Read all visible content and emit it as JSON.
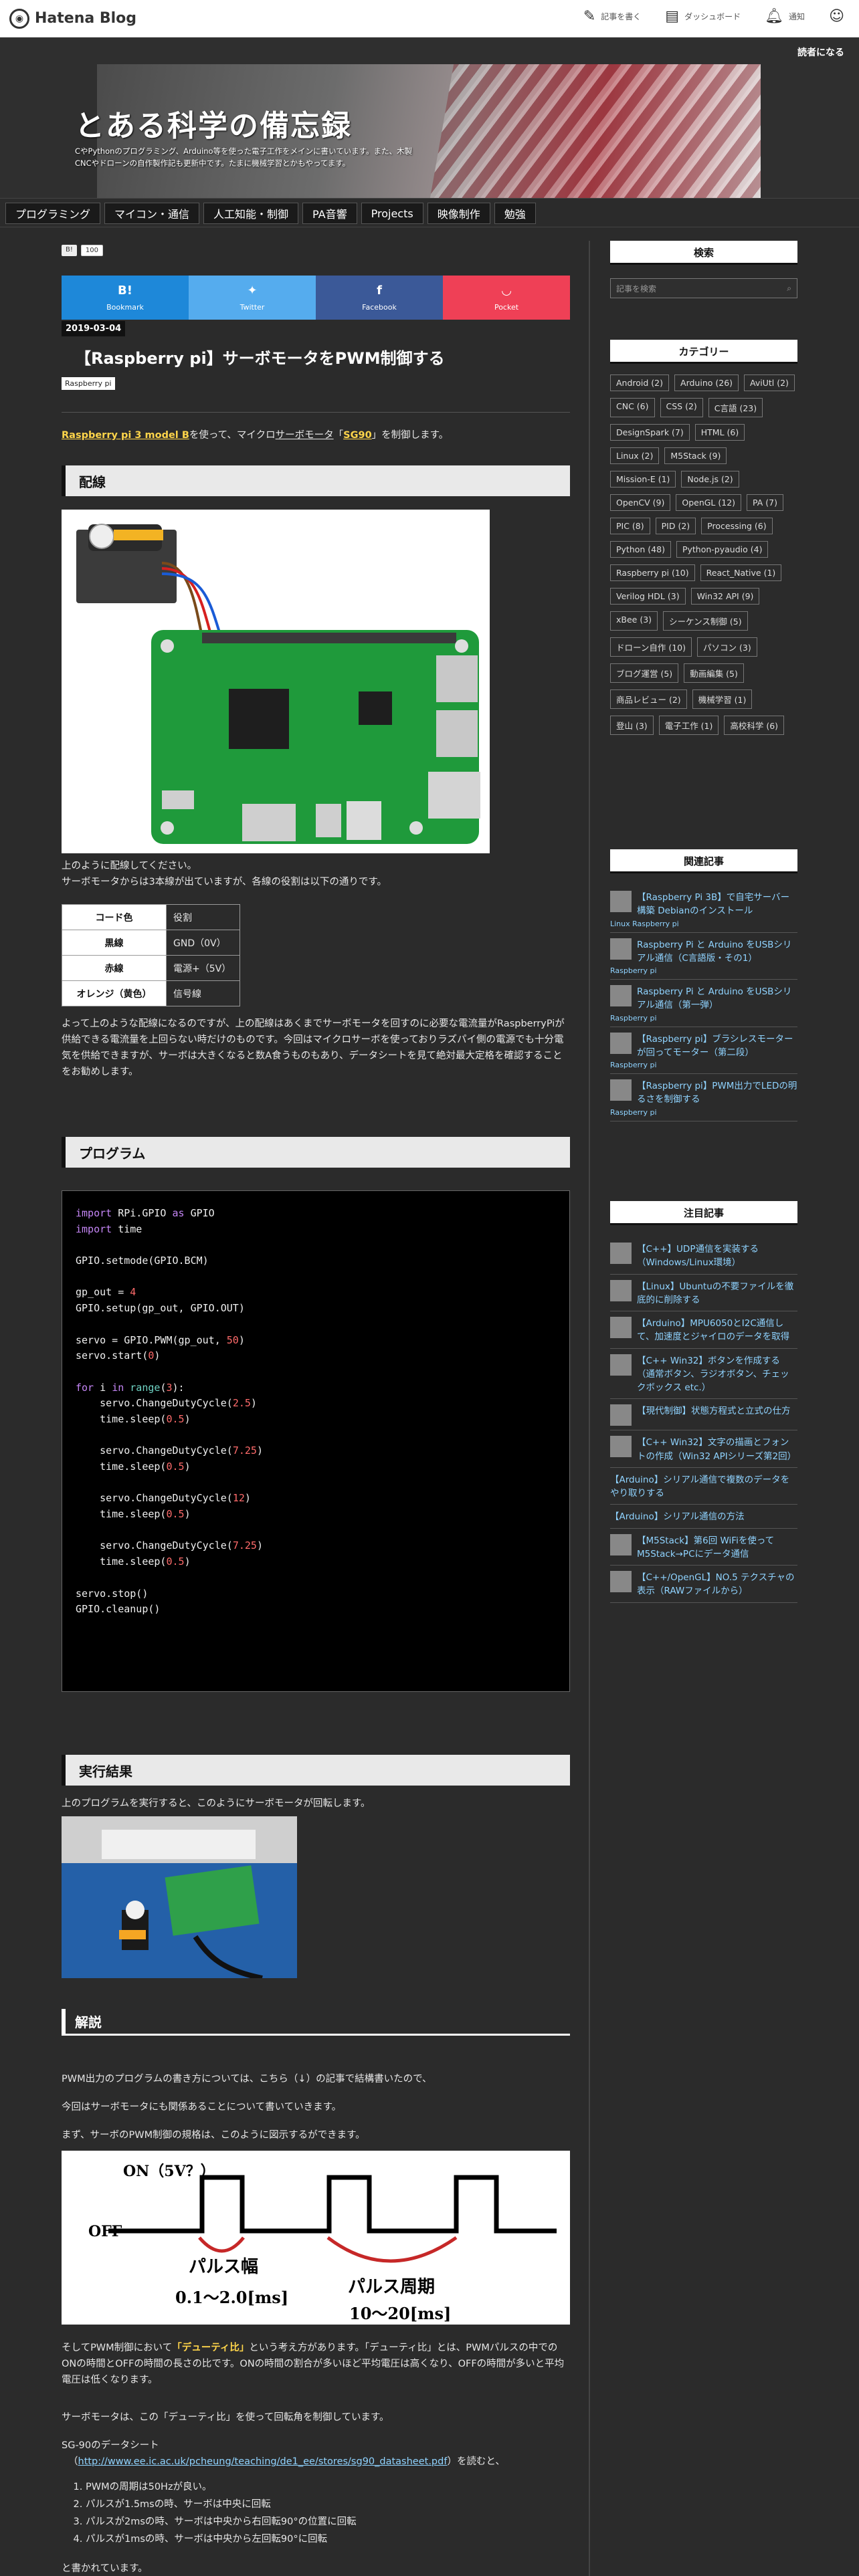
{
  "topbar": {
    "logo": "Hatena Blog",
    "tools": [
      {
        "icon": "pencil-icon",
        "label": "記事を書く"
      },
      {
        "icon": "dashboard-icon",
        "label": "ダッシュボード"
      },
      {
        "icon": "bell-icon",
        "label": "通知"
      },
      {
        "icon": "user-icon",
        "label": ""
      }
    ]
  },
  "header": {
    "reader_label": "読者になる",
    "title": "とある科学の備忘録",
    "description": "CやPythonのプログラミング、Arduino等を使った電子工作をメインに書いています。また、木製CNCやドローンの自作製作記も更新中です。たまに機械学習とかもやってます。"
  },
  "nav": [
    "プログラミング",
    "マイコン・通信",
    "人工知能・制御",
    "PA音響",
    "Projects",
    "映像制作",
    "勉強"
  ],
  "article": {
    "hatena_bookmark": "B!",
    "bookmark_count": "100",
    "share": [
      {
        "name": "Bookmark",
        "color": "#1e88d9"
      },
      {
        "name": "Twitter",
        "color": "#55acee"
      },
      {
        "name": "Facebook",
        "color": "#3b5998"
      },
      {
        "name": "Pocket",
        "color": "#ef4056"
      }
    ],
    "date": "2019-03-04",
    "title": "【Raspberry pi】サーボモータをPWM制御する",
    "category": "Raspberry pi",
    "intro_link1": "Raspberry pi 3 model B",
    "intro_mid": "を使って、マイクロ",
    "intro_link2": "サーボモータ",
    "intro_mid2": "「",
    "intro_link3": "SG90",
    "intro_end": "」を制御します。",
    "sec_wiring": "配線",
    "wiring_p1": "上のように配線してください。",
    "wiring_p2": "サーボモータからは3本線が出ていますが、各線の役割は以下の通りです。",
    "table_headers": [
      "コード色",
      "役割"
    ],
    "table_rows": [
      [
        "黒線",
        "GND（0V）"
      ],
      [
        "赤線",
        "電源+（5V）"
      ],
      [
        "オレンジ（黄色）",
        "信号線"
      ]
    ],
    "note": "よって上のような配線になるのですが、上の配線はあくまでサーボモータを回すのに必要な電流量がRaspberryPiが供給できる電流量を上回らない時だけのものです。今回はマイクロサーボを使っておりラズパイ側の電源でも十分電気を供給できますが、サーボは大きくなると数A食うものもあり、データシートを見て絶対最大定格を確認することをお勧めします。",
    "sec_program": "プログラム",
    "code_lines": [
      "import RPi.GPIO as GPIO",
      "import time",
      "",
      "GPIO.setmode(GPIO.BCM)",
      "",
      "gp_out = 4",
      "GPIO.setup(gp_out, GPIO.OUT)",
      "",
      "servo = GPIO.PWM(gp_out, 50)",
      "servo.start(0)",
      "",
      "for i in range(3):",
      "    servo.ChangeDutyCycle(2.5)",
      "    time.sleep(0.5)",
      "",
      "    servo.ChangeDutyCycle(7.25)",
      "    time.sleep(0.5)",
      "",
      "    servo.ChangeDutyCycle(12)",
      "    time.sleep(0.5)",
      "",
      "    servo.ChangeDutyCycle(7.25)",
      "    time.sleep(0.5)",
      "",
      "servo.stop()",
      "GPIO.cleanup()"
    ],
    "sec_result": "実行結果",
    "result_p": "上のプログラムを実行すると、このようにサーボモータが回転します。",
    "sec_explain": "解説",
    "explain_p1": "PWM出力のプログラムの書き方については、こちら（↓）の記事で結構書いたので、",
    "explain_p2": "今回はサーボモータにも関係あることについて書いていきます。",
    "explain_p3": "まず、サーボのPWM制御の規格は、このように図示するができます。",
    "pwm_diagram": {
      "on_label": "ON（5V？）",
      "off_label": "OFF",
      "width_label": "パルス幅",
      "width_range": "0.1〜2.0[ms]",
      "period_label": "パルス周期",
      "period_range": "10〜20[ms]"
    },
    "duty_p": "そしてPWM制御において「デューティ比」という考え方があります。「デューティ比」とは、PWMパルスの中でのONの時間とOFFの時間の長さの比です。ONの時間の割合が多いほど平均電圧は高くなり、OFFの時間が多いと平均電圧は低くなります。",
    "duty_highlight": "「デューティ比」",
    "servo_p": "サーボモータは、この「デューティ比」を使って回転角を制御しています。",
    "datasheet_label": "SG-90のデータシート",
    "datasheet_url": "http://www.ee.ic.ac.uk/pcheung/teaching/de1_ee/stores/sg90_datasheet.pdf",
    "datasheet_suffix": "）を読むと、",
    "list": [
      "PWMの周期は50Hzが良い。",
      "パルスが1.5msの時、サーボは中央に回転",
      "パルスが2msの時、サーボは中央から右回転90°の位置に回転",
      "パルスが1msの時、サーボは中央から左回転90°に回転"
    ],
    "closing": "と書かれています。"
  },
  "sidebar": {
    "search_title": "検索",
    "search_placeholder": "記事を検索",
    "category_title": "カテゴリー",
    "categories": [
      "Android (2)",
      "Arduino (26)",
      "AviUtl (2)",
      "CNC (6)",
      "CSS (2)",
      "C言語 (23)",
      "DesignSpark (7)",
      "HTML (6)",
      "Linux (2)",
      "M5Stack (9)",
      "Mission-E (1)",
      "Node.js (2)",
      "OpenCV (9)",
      "OpenGL (12)",
      "PA (7)",
      "PIC (8)",
      "PID (2)",
      "Processing (6)",
      "Python (48)",
      "Python-pyaudio (4)",
      "Raspberry pi (10)",
      "React_Native (1)",
      "Verilog HDL (3)",
      "Win32 API (9)",
      "xBee (3)",
      "シーケンス制御 (5)",
      "ドローン自作 (10)",
      "パソコン (3)",
      "ブログ運営 (5)",
      "動画編集 (5)",
      "商品レビュー (2)",
      "機械学習 (1)",
      "登山 (3)",
      "電子工作 (1)",
      "高校科学 (6)"
    ],
    "related_title": "関連記事",
    "related": [
      {
        "title": "【Raspberry Pi 3B】で自宅サーバー構築 Debianのインストール",
        "cat": "Linux   Raspberry pi",
        "thumb": true
      },
      {
        "title": "Raspberry Pi と Arduino をUSBシリアル通信（C言語版・その1）",
        "cat": "Raspberry pi",
        "thumb": true
      },
      {
        "title": "Raspberry Pi と Arduino をUSBシリアル通信（第一弾）",
        "cat": "Raspberry pi",
        "thumb": true
      },
      {
        "title": "【Raspberry pi】ブラシレスモーターが回ってモーター（第二段）",
        "cat": "Raspberry pi",
        "thumb": true
      },
      {
        "title": "【Raspberry pi】PWM出力でLEDの明るさを制御する",
        "cat": "Raspberry pi",
        "thumb": true
      }
    ],
    "featured_title": "注目記事",
    "featured": [
      {
        "title": "【C++】UDP通信を実装する（Windows/Linux環境）",
        "thumb": true
      },
      {
        "title": "【Linux】Ubuntuの不要ファイルを徹底的に削除する",
        "thumb": true
      },
      {
        "title": "【Arduino】MPU6050とI2C通信して、加速度とジャイロのデータを取得",
        "thumb": true
      },
      {
        "title": "【C++ Win32】ボタンを作成する（通常ボタン、ラジオボタン、チェックボックス etc.）",
        "thumb": true
      },
      {
        "title": "【現代制御】状態方程式と立式の仕方",
        "thumb": true
      },
      {
        "title": "【C++ Win32】文字の描画とフォントの作成（Win32 APIシリーズ第2回）",
        "thumb": true
      },
      {
        "title": "【Arduino】シリアル通信で複数のデータをやり取りする",
        "thumb": false
      },
      {
        "title": "【Arduino】シリアル通信の方法",
        "thumb": false
      },
      {
        "title": "【M5Stack】第6回 WiFiを使ってM5Stack→PCにデータ通信",
        "thumb": true
      },
      {
        "title": "【C++/OpenGL】NO.5 テクスチャの表示（RAWファイルから）",
        "thumb": true
      }
    ]
  },
  "colors": {
    "highlight": "#ffd54a",
    "link": "#8fd3ff",
    "background": "#2b2b2b"
  }
}
